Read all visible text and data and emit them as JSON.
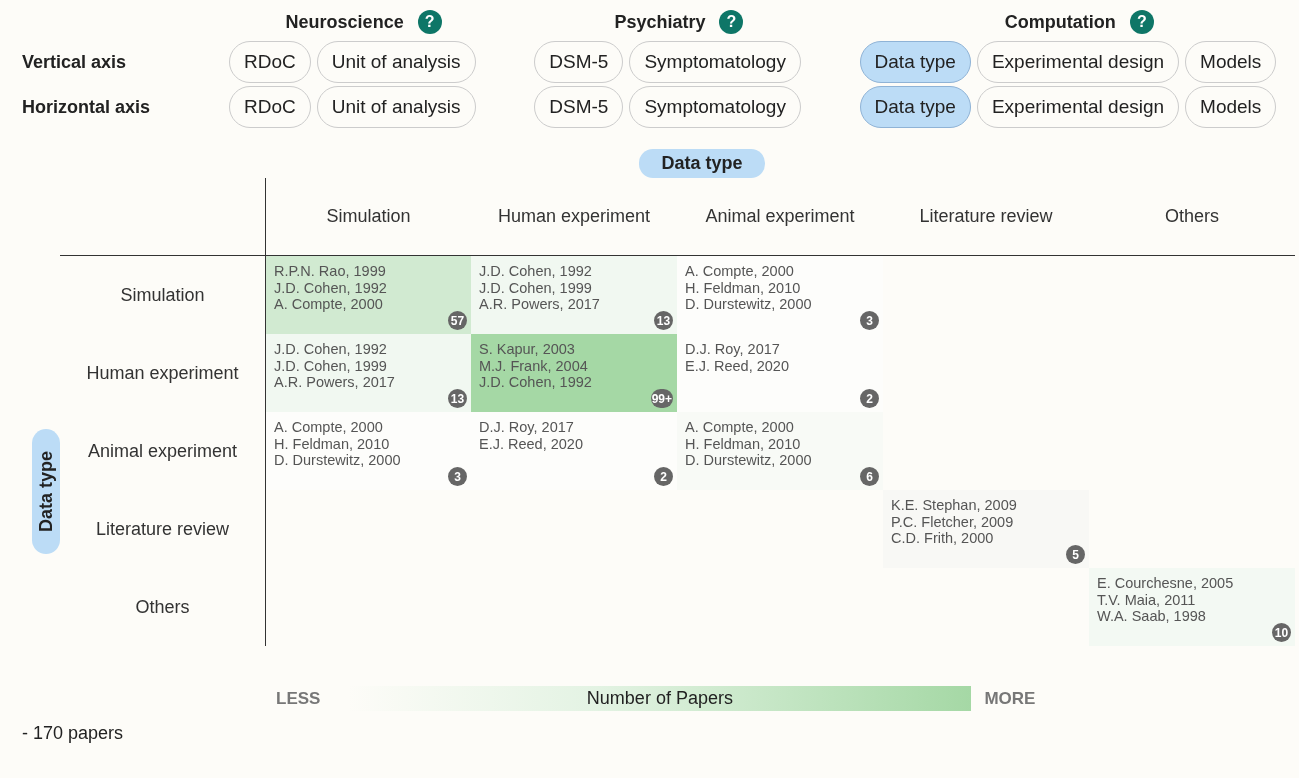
{
  "groups": [
    {
      "title": "Neuroscience",
      "help": "?"
    },
    {
      "title": "Psychiatry",
      "help": "?"
    },
    {
      "title": "Computation",
      "help": "?"
    }
  ],
  "axes": [
    {
      "label": "Vertical axis",
      "groups": [
        {
          "options": [
            {
              "label": "RDoC",
              "selected": false
            },
            {
              "label": "Unit of analysis",
              "selected": false
            }
          ]
        },
        {
          "options": [
            {
              "label": "DSM-5",
              "selected": false
            },
            {
              "label": "Symptomatology",
              "selected": false
            }
          ]
        },
        {
          "options": [
            {
              "label": "Data type",
              "selected": true
            },
            {
              "label": "Experimental design",
              "selected": false
            },
            {
              "label": "Models",
              "selected": false
            }
          ]
        }
      ]
    },
    {
      "label": "Horizontal axis",
      "groups": [
        {
          "options": [
            {
              "label": "RDoC",
              "selected": false
            },
            {
              "label": "Unit of analysis",
              "selected": false
            }
          ]
        },
        {
          "options": [
            {
              "label": "DSM-5",
              "selected": false
            },
            {
              "label": "Symptomatology",
              "selected": false
            }
          ]
        },
        {
          "options": [
            {
              "label": "Data type",
              "selected": true
            },
            {
              "label": "Experimental design",
              "selected": false
            },
            {
              "label": "Models",
              "selected": false
            }
          ]
        }
      ]
    }
  ],
  "matrix": {
    "column_axis": "Data type",
    "row_axis": "Data type",
    "columns": [
      "Simulation",
      "Human experiment",
      "Animal experiment",
      "Literature review",
      "Others"
    ],
    "rows": [
      {
        "label": "Simulation",
        "cells": [
          {
            "kind": "filled",
            "color": "#d1ead1",
            "papers": [
              "R.P.N. Rao, 1999",
              "J.D. Cohen, 1992",
              "A. Compte, 2000"
            ],
            "count": "57"
          },
          {
            "kind": "filled",
            "color": "#f1f8f1",
            "papers": [
              "J.D. Cohen, 1992",
              "J.D. Cohen, 1999",
              "A.R. Powers, 2017"
            ],
            "count": "13"
          },
          {
            "kind": "filled",
            "color": "#fdfdfb",
            "papers": [
              "A. Compte, 2000",
              "H. Feldman, 2010",
              "D. Durstewitz, 2000"
            ],
            "count": "3"
          },
          {
            "kind": "empty"
          },
          {
            "kind": "empty"
          }
        ]
      },
      {
        "label": "Human experiment",
        "cells": [
          {
            "kind": "filled",
            "color": "#f1f8f1",
            "papers": [
              "J.D. Cohen, 1992",
              "J.D. Cohen, 1999",
              "A.R. Powers, 2017"
            ],
            "count": "13"
          },
          {
            "kind": "filled",
            "color": "#a5d8a5",
            "papers": [
              "S. Kapur, 2003",
              "M.J. Frank, 2004",
              "J.D. Cohen, 1992"
            ],
            "count": "99+"
          },
          {
            "kind": "filled",
            "color": "#fdfdfb",
            "papers": [
              "D.J. Roy, 2017",
              "E.J. Reed, 2020"
            ],
            "count": "2"
          },
          {
            "kind": "empty"
          },
          {
            "kind": "empty"
          }
        ]
      },
      {
        "label": "Animal experiment",
        "cells": [
          {
            "kind": "filled",
            "color": "#fdfdfb",
            "papers": [
              "A. Compte, 2000",
              "H. Feldman, 2010",
              "D. Durstewitz, 2000"
            ],
            "count": "3"
          },
          {
            "kind": "filled",
            "color": "#fdfdfb",
            "papers": [
              "D.J. Roy, 2017",
              "E.J. Reed, 2020"
            ],
            "count": "2"
          },
          {
            "kind": "filled",
            "color": "#f8faf6",
            "papers": [
              "A. Compte, 2000",
              "H. Feldman, 2010",
              "D. Durstewitz, 2000"
            ],
            "count": "6"
          },
          {
            "kind": "empty"
          },
          {
            "kind": "empty"
          }
        ]
      },
      {
        "label": "Literature review",
        "cells": [
          {
            "kind": "empty"
          },
          {
            "kind": "empty"
          },
          {
            "kind": "empty"
          },
          {
            "kind": "filled",
            "color": "#f8f8f5",
            "papers": [
              "K.E. Stephan, 2009",
              "P.C. Fletcher, 2009",
              "C.D. Frith, 2000"
            ],
            "count": "5"
          },
          {
            "kind": "empty"
          }
        ]
      },
      {
        "label": "Others",
        "cells": [
          {
            "kind": "empty"
          },
          {
            "kind": "empty"
          },
          {
            "kind": "empty"
          },
          {
            "kind": "empty"
          },
          {
            "kind": "filled",
            "color": "#f3f9f3",
            "papers": [
              "E. Courchesne, 2005",
              "T.V. Maia, 2011",
              "W.A. Saab, 1998"
            ],
            "count": "10"
          }
        ]
      }
    ]
  },
  "legend": {
    "less": "LESS",
    "title": "Number of Papers",
    "more": "MORE"
  },
  "footer": "- 170 papers"
}
